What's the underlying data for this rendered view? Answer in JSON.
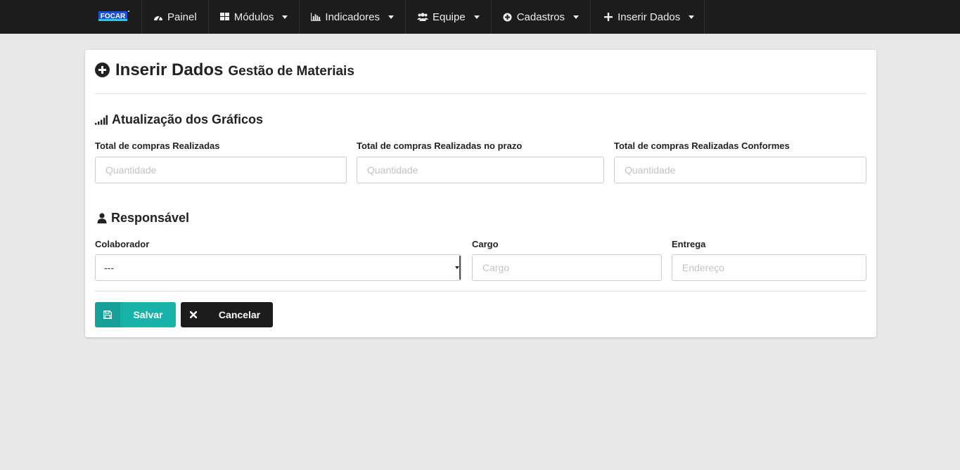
{
  "brand": {
    "logo_text": "FOCAR"
  },
  "nav": {
    "items": [
      {
        "label": "Painel",
        "icon": "dashboard-icon"
      },
      {
        "label": "Módulos",
        "icon": "grid-icon"
      },
      {
        "label": "Indicadores",
        "icon": "bar-chart-icon"
      },
      {
        "label": "Equipe",
        "icon": "users-icon"
      },
      {
        "label": "Cadastros",
        "icon": "plus-circle-icon"
      },
      {
        "label": "Inserir Dados",
        "icon": "plus-icon"
      }
    ]
  },
  "page": {
    "title": "Inserir Dados",
    "subtitle": "Gestão de Materiais"
  },
  "graficos": {
    "title": "Atualização dos Gráficos",
    "fields": [
      {
        "label": "Total de compras Realizadas",
        "placeholder": "Quantidade"
      },
      {
        "label": "Total de compras Realizadas no prazo",
        "placeholder": "Quantidade"
      },
      {
        "label": "Total de compras Realizadas Conformes",
        "placeholder": "Quantidade"
      }
    ]
  },
  "responsavel": {
    "title": "Responsável",
    "colaborador": {
      "label": "Colaborador",
      "value": "---"
    },
    "cargo": {
      "label": "Cargo",
      "placeholder": "Cargo"
    },
    "entrega": {
      "label": "Entrega",
      "placeholder": "Endereço"
    }
  },
  "actions": {
    "save_label": "Salvar",
    "cancel_label": "Cancelar"
  },
  "colors": {
    "navbar": "#1c1c1c",
    "save": "#17b3a8",
    "cancel": "#1c1c1c",
    "background": "#e8e8e8"
  }
}
